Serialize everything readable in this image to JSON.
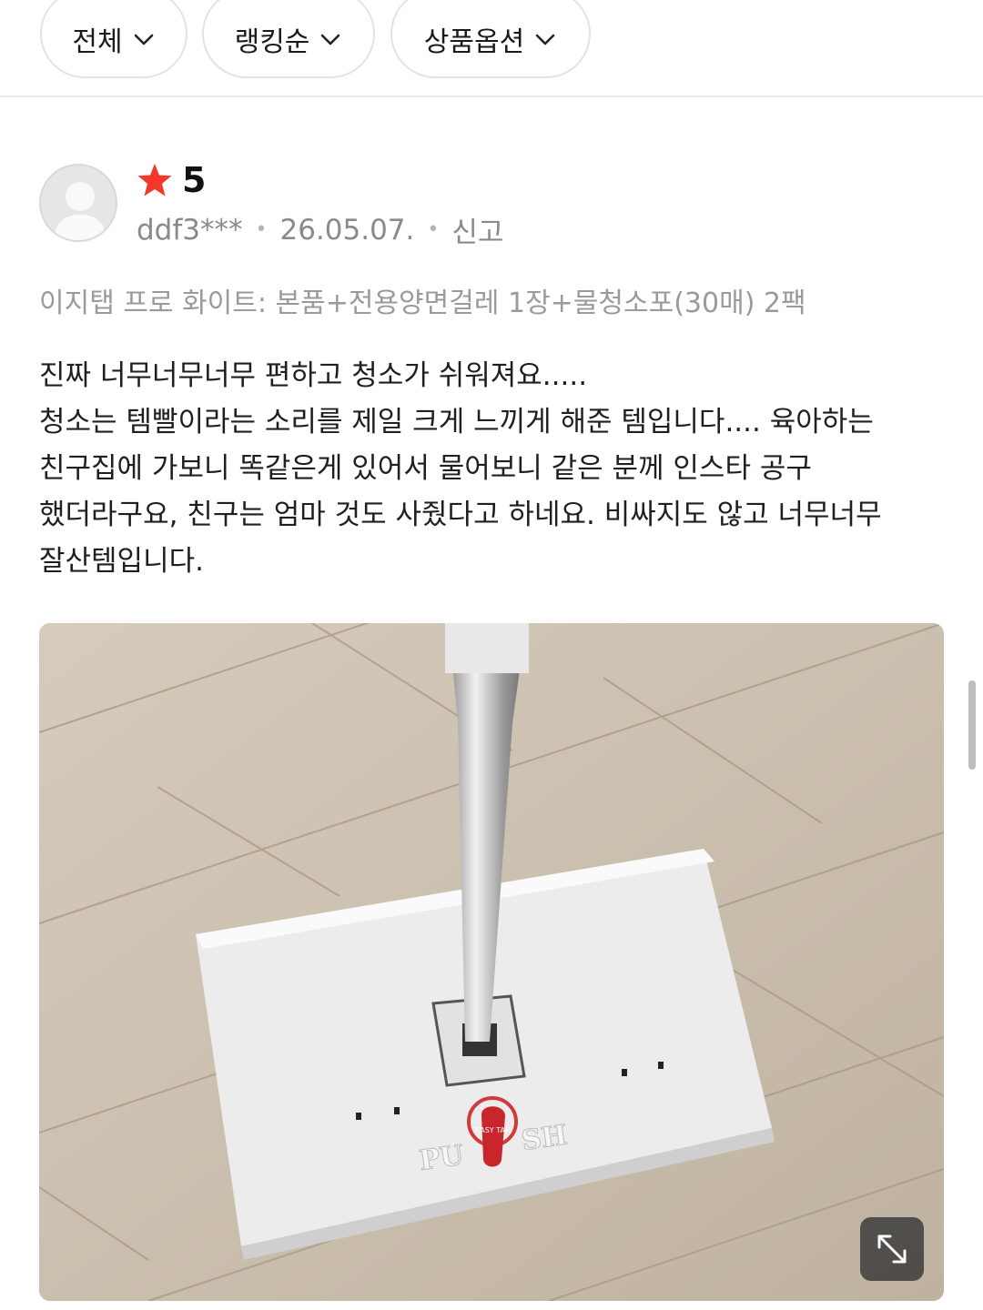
{
  "filters": {
    "all_label": "전체",
    "ranking_label": "랭킹순",
    "option_label": "상품옵션"
  },
  "review": {
    "rating": "5",
    "user": "ddf3***",
    "date": "26.05.07.",
    "report_label": "신고",
    "product_option": "이지탭 프로 화이트: 본품+전용양면걸레 1장+물청소포(30매) 2팩",
    "body_lines": [
      "진짜 너무너무너무 편하고 청소가 쉬워져요.....",
      "청소는 템빨이라는 소리를 제일 크게 느끼게 해준 템입니다.... 육아하는",
      "친구집에 가보니 똑같은게 있어서 물어보니 같은 분께 인스타 공구",
      "했더라구요, 친구는 엄마 것도 사줬다고 하네요. 비싸지도 않고 너무너무",
      "잘산템입니다."
    ],
    "photo": {
      "text_left": "PU",
      "text_right": "SH",
      "badge_text": "EASY TAP"
    }
  },
  "colors": {
    "star": "#f2372b",
    "muted_text": "#8a8a8a"
  },
  "icons": {
    "chevron": "chevron-down-icon",
    "star": "star-icon",
    "expand": "expand-icon",
    "avatar": "user-avatar-icon"
  }
}
